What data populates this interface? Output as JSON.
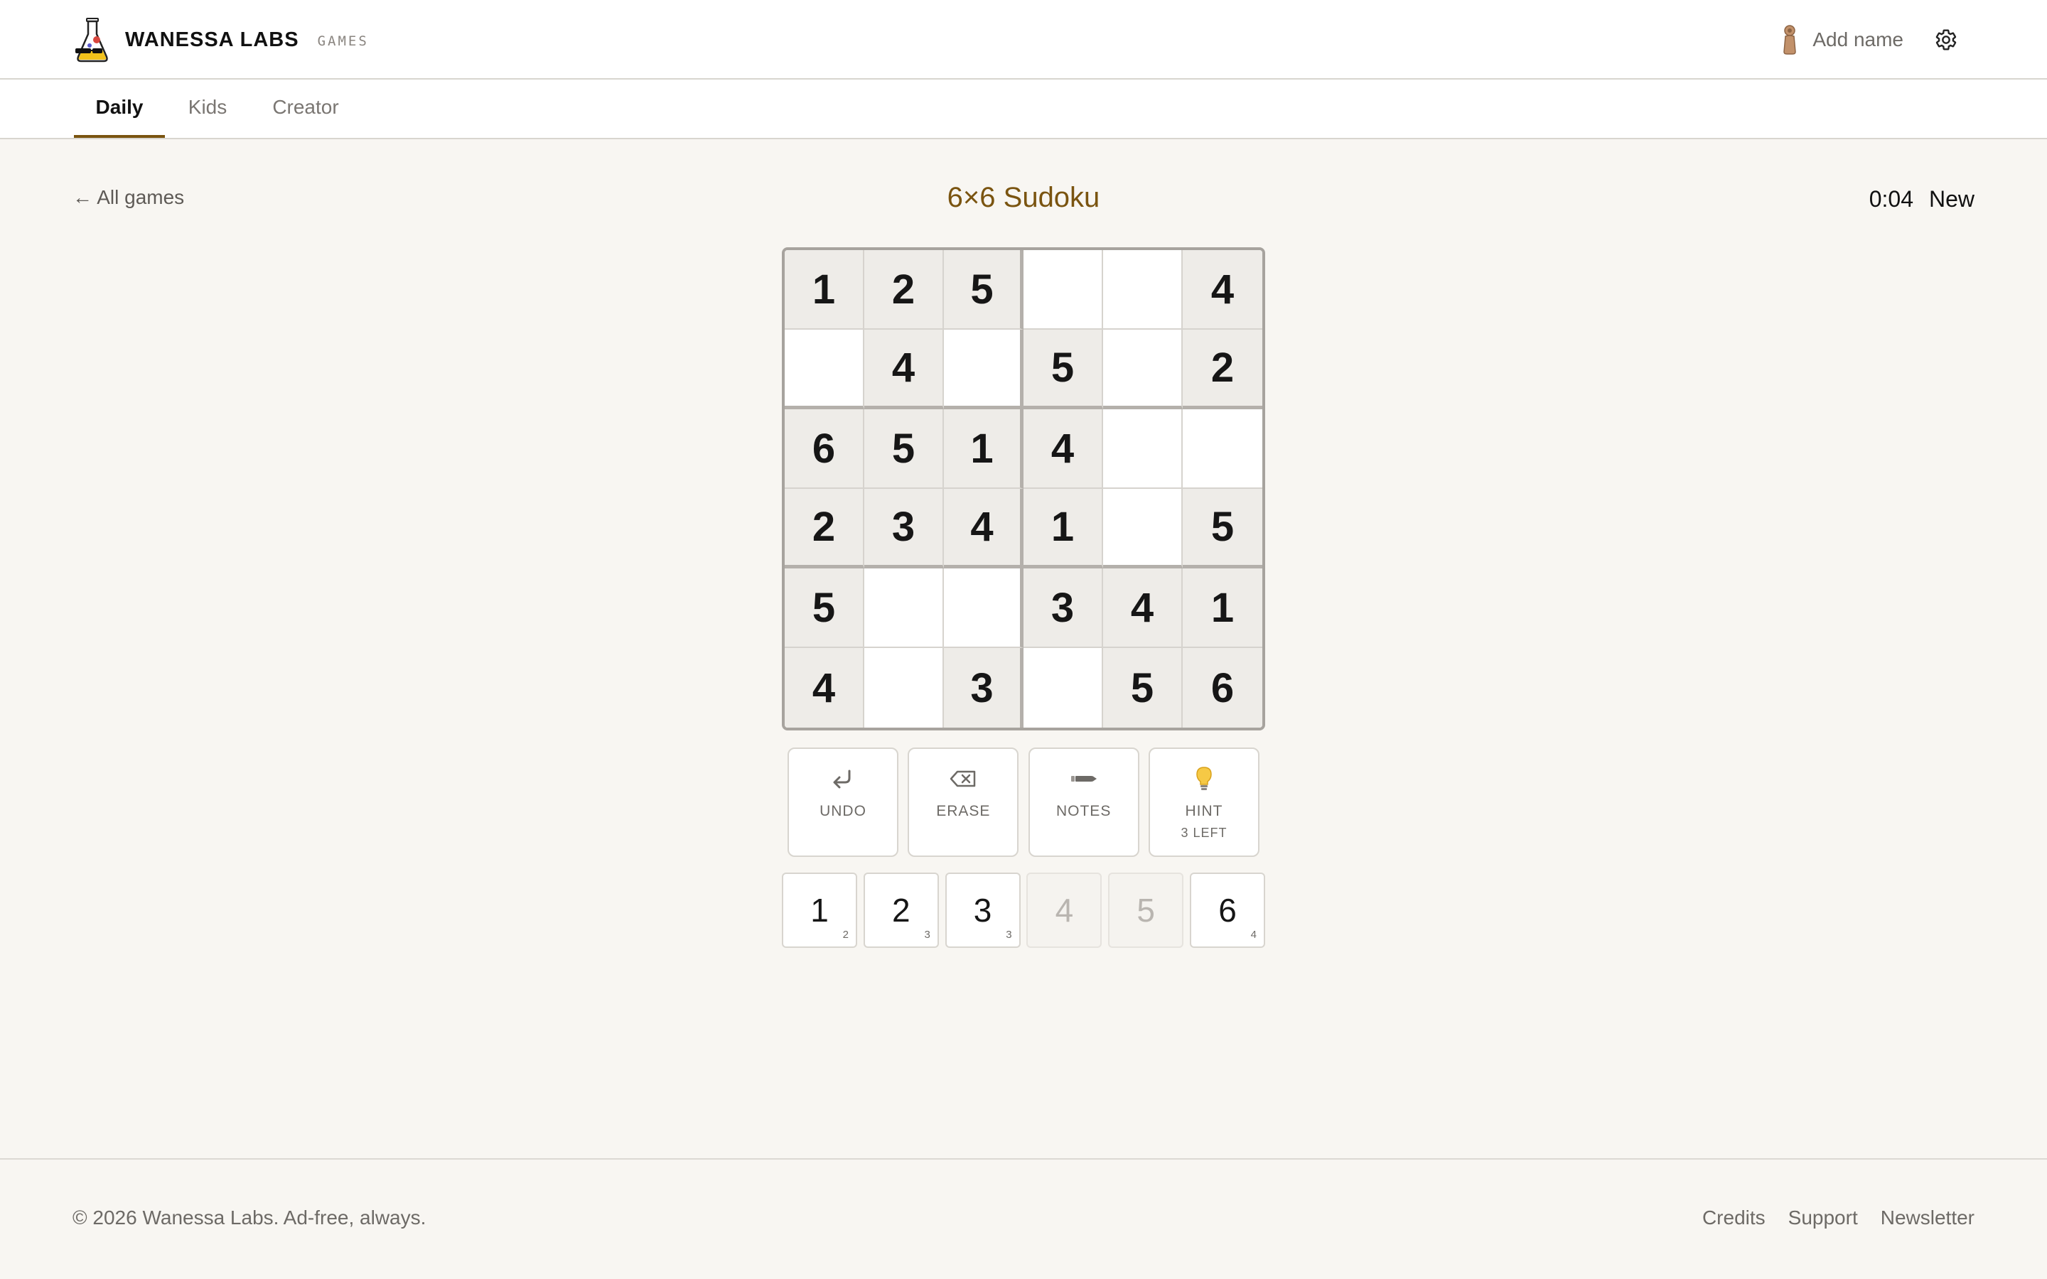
{
  "brand": {
    "name": "WANESSA LABS",
    "sub": "GAMES",
    "logo_icon": "flask-sunglasses-icon"
  },
  "user": {
    "add_name_label": "Add name",
    "avatar_icon": "pawn-avatar-icon",
    "settings_icon": "gear-icon"
  },
  "tabs": [
    {
      "label": "Daily",
      "active": true
    },
    {
      "label": "Kids",
      "active": false
    },
    {
      "label": "Creator",
      "active": false
    }
  ],
  "game": {
    "back_label": "← All games",
    "title": "6×6 Sudoku",
    "timer": "0:04",
    "new_label": "New"
  },
  "board": {
    "size": 6,
    "box_rows": 2,
    "box_cols": 3,
    "cells": [
      [
        1,
        2,
        5,
        null,
        null,
        4
      ],
      [
        null,
        4,
        null,
        5,
        null,
        2
      ],
      [
        6,
        5,
        1,
        4,
        null,
        null
      ],
      [
        2,
        3,
        4,
        1,
        null,
        5
      ],
      [
        5,
        null,
        null,
        3,
        4,
        1
      ],
      [
        4,
        null,
        3,
        null,
        5,
        6
      ]
    ]
  },
  "tools": [
    {
      "name": "undo",
      "label": "UNDO",
      "icon": "undo-arrow-icon",
      "sub": ""
    },
    {
      "name": "erase",
      "label": "ERASE",
      "icon": "eraser-icon",
      "sub": ""
    },
    {
      "name": "notes",
      "label": "NOTES",
      "icon": "pencil-icon",
      "sub": ""
    },
    {
      "name": "hint",
      "label": "HINT",
      "icon": "lightbulb-icon",
      "sub": "3 LEFT"
    }
  ],
  "numpad": [
    {
      "digit": "1",
      "remaining": "2",
      "complete": false
    },
    {
      "digit": "2",
      "remaining": "3",
      "complete": false
    },
    {
      "digit": "3",
      "remaining": "3",
      "complete": false
    },
    {
      "digit": "4",
      "remaining": "",
      "complete": true
    },
    {
      "digit": "5",
      "remaining": "",
      "complete": true
    },
    {
      "digit": "6",
      "remaining": "4",
      "complete": false
    }
  ],
  "footer": {
    "copyright": "© 2026 Wanessa Labs. Ad-free, always.",
    "links": [
      "Credits",
      "Support",
      "Newsletter"
    ]
  },
  "colors": {
    "accent": "#7a5410",
    "background": "#f8f6f2",
    "given_cell": "#eeece8"
  }
}
